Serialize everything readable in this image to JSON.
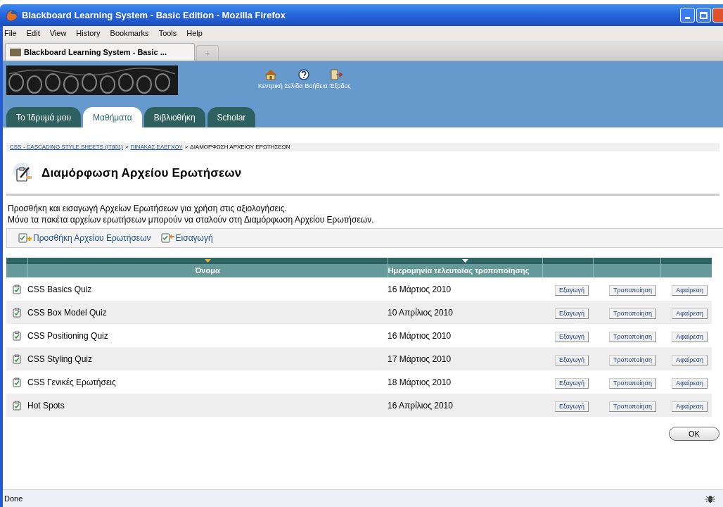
{
  "window": {
    "title": "Blackboard Learning System - Basic Edition - Mozilla Firefox"
  },
  "menu": [
    "File",
    "Edit",
    "View",
    "History",
    "Bookmarks",
    "Tools",
    "Help"
  ],
  "browser_tabs": [
    {
      "label": "Blackboard Learning System - Basic ...",
      "selected": true
    }
  ],
  "new_tab": "+",
  "header_links": [
    {
      "kind": "home",
      "label": "Κεντρική Σελίδα"
    },
    {
      "kind": "help",
      "label": "Βοήθεια"
    },
    {
      "kind": "exit",
      "label": "Έξοδος"
    }
  ],
  "nav_tabs": [
    {
      "label": "Το Ίδρυμά μου",
      "selected": false
    },
    {
      "label": "Μαθήματα",
      "selected": true
    },
    {
      "label": "Βιβλιοθήκη",
      "selected": false
    },
    {
      "label": "Scholar",
      "selected": false
    }
  ],
  "breadcrumb": [
    {
      "label": "CSS - CASCADING STYLE SHEETS (IT801)",
      "link": true
    },
    {
      "label": "ΠΙΝΑΚΑΣ ΕΛΕΓΧΟΥ",
      "link": true
    },
    {
      "label": "ΔΙΑΜΟΡΦΩΣΗ ΑΡΧΕΙΟΥ ΕΡΩΤΗΣΕΩΝ",
      "link": false
    }
  ],
  "breadcrumb_separator": ">",
  "page_title": "Διαμόρφωση Αρχείου Ερωτήσεων",
  "description": [
    "Προσθήκη και εισαγωγή Αρχείων Ερωτήσεων για χρήση στις αξιολογήσεις.",
    "Μόνο τα πακέτα αρχείων ερωτήσεων μπορούν να σταλούν στη Διαμόρφωση Αρχείου Ερωτήσεων."
  ],
  "actions": [
    {
      "kind": "add",
      "label": "Προσθήκη Αρχείου Ερωτήσεων"
    },
    {
      "kind": "import",
      "label": "Εισαγωγή"
    }
  ],
  "table": {
    "columns": [
      {
        "label": "Όνομα",
        "sorted": true
      },
      {
        "label": "Ημερομηνία τελευταίας τροποποίησης",
        "sorted": false
      }
    ],
    "rows": [
      {
        "name": "CSS Basics Quiz",
        "date": "16 Μάρτιος 2010",
        "buttons": [
          "Εξαγωγή",
          "Τροποποίηση",
          "Αφαίρεση"
        ]
      },
      {
        "name": "CSS Box Model Quiz",
        "date": "10 Απρίλιος 2010",
        "buttons": [
          "Εξαγωγή",
          "Τροποποίηση",
          "Αφαίρεση"
        ]
      },
      {
        "name": "CSS Positioning Quiz",
        "date": "16 Μάρτιος 2010",
        "buttons": [
          "Εξαγωγή",
          "Τροποποίηση",
          "Αφαίρεση"
        ]
      },
      {
        "name": "CSS Styling Quiz",
        "date": "17 Μάρτιος 2010",
        "buttons": [
          "Εξαγωγή",
          "Τροποποίηση",
          "Αφαίρεση"
        ]
      },
      {
        "name": "CSS Γενικές Ερωτήσεις",
        "date": "18 Μάρτιος 2010",
        "buttons": [
          "Εξαγωγή",
          "Τροποποίηση",
          "Αφαίρεση"
        ]
      },
      {
        "name": "Hot Spots",
        "date": "16 Απρίλιος 2010",
        "buttons": [
          "Εξαγωγή",
          "Τροποποίηση",
          "Αφαίρεση"
        ]
      }
    ]
  },
  "ok_button": "OK",
  "status_bar": {
    "text": "Done"
  }
}
